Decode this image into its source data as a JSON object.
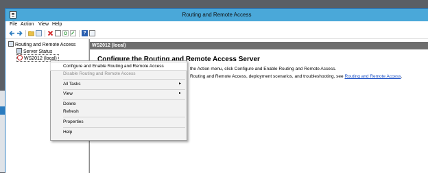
{
  "window": {
    "title": "Routing and Remote Access"
  },
  "menubar": {
    "items": [
      "File",
      "Action",
      "View",
      "Help"
    ]
  },
  "toolbar": {
    "icons": [
      "back-arrow-icon",
      "forward-arrow-icon",
      "folder-icon",
      "console-tree-icon",
      "delete-icon",
      "properties-icon",
      "refresh-icon",
      "export-icon",
      "help-icon",
      "panel-icon"
    ],
    "colors": {
      "back": "#2a7bbf",
      "forward": "#2a7bbf",
      "delete": "#d42a2a"
    }
  },
  "tree": {
    "root": "Routing and Remote Access",
    "items": [
      "Server Status",
      "WS2012 (local)"
    ]
  },
  "content": {
    "header": "WS2012 (local)",
    "heading": "Configure the Routing and Remote Access Server",
    "line1": "the Action menu, click Configure and Enable Routing and Remote Access.",
    "line2_prefix": "Routing and Remote Access, deployment scenarios, and troubleshooting, see ",
    "line2_link": "Routing and Remote Access",
    "line2_suffix": "."
  },
  "context_menu": {
    "items": [
      {
        "label": "Configure and Enable Routing and Remote Access",
        "enabled": true,
        "highlighted": true
      },
      {
        "label": "Disable Routing and Remote Access",
        "enabled": false
      },
      {
        "label": "All Tasks",
        "submenu": true
      },
      {
        "label": "View",
        "submenu": true
      },
      {
        "label": "Delete"
      },
      {
        "label": "Refresh"
      },
      {
        "label": "Properties"
      },
      {
        "label": "Help"
      }
    ],
    "arrow": "▸"
  }
}
